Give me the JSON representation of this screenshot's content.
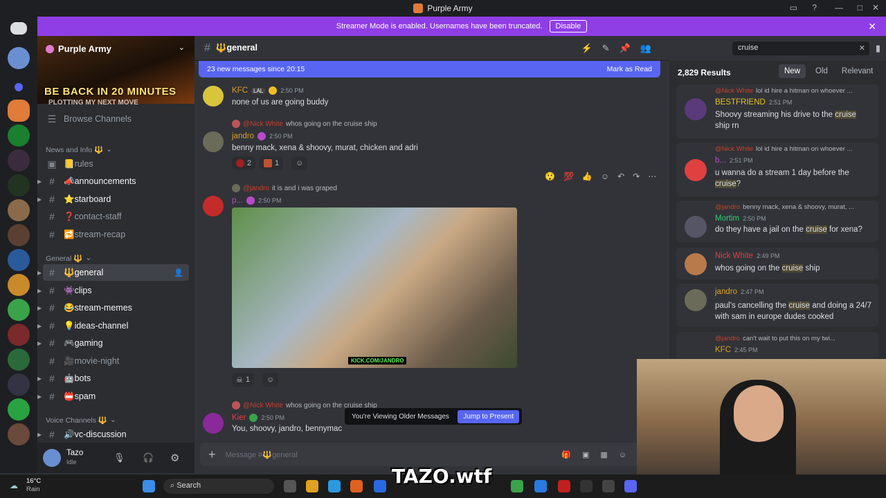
{
  "window": {
    "title": "Purple Army"
  },
  "banner": {
    "text": "Streamer Mode is enabled. Usernames have been truncated.",
    "button": "Disable"
  },
  "server": {
    "name": "Purple Army",
    "banner_text": "BE BACK IN 20 MINUTES",
    "banner_subtext": "PLOTTING MY NEXT MOVE",
    "browse": "Browse Channels",
    "categories": [
      {
        "name": "News and Info 🔱",
        "channels": [
          "📒rules",
          "📣announcements",
          "⭐starboard",
          "❓contact-staff",
          "🔁stream-recap"
        ]
      },
      {
        "name": "General 🔱",
        "channels": [
          "🔱general",
          "👾clips",
          "😂stream-memes",
          "💡ideas-channel",
          "🎮gaming",
          "🎥movie-night",
          "🤖bots",
          "📛spam"
        ]
      },
      {
        "name": "Voice Channels 🔱",
        "channels": [
          "🔊vc-discussion"
        ]
      }
    ]
  },
  "user": {
    "name": "Tazo",
    "status": "Idle"
  },
  "chat": {
    "channel": "🔱general",
    "new_messages": "23 new messages since 20:15",
    "mark_read": "Mark as Read",
    "messages": [
      {
        "author": "KFC",
        "tag": "LAL",
        "time": "2:50 PM",
        "text": "none of us are going buddy"
      },
      {
        "reply_name": "@Nick White",
        "reply_text": "whos going on the cruise ship",
        "author": "jandro",
        "time": "2:50 PM",
        "text": "benny mack, xena & shoovy, murat, chicken and adri",
        "reactions": [
          "2",
          "1"
        ]
      },
      {
        "reply_name": "@jandro",
        "reply_text": "it is and i was graped",
        "author": "p...",
        "time": "2:50 PM",
        "image_caption": "KICK.COM/JANDRO",
        "reactions": [
          "1"
        ]
      },
      {
        "reply_name": "@Nick White",
        "reply_text": "whos going on the cruise ship",
        "author": "Kier",
        "time": "2:50 PM",
        "text": "You, shoovy, jandro, bennymac"
      }
    ],
    "older_notice": "You're Viewing Older Messages",
    "jump": "Jump to Present",
    "input_placeholder": "Message #🔱general"
  },
  "search": {
    "query": "cruise",
    "count": "2,829 Results",
    "tabs": [
      "New",
      "Old",
      "Relevant"
    ],
    "results": [
      {
        "reply_name": "@Nick White",
        "reply_text": "lol id hire a hitman on whoever ...",
        "author": "BESTFRIEND",
        "time": "2:51 PM",
        "text_before": "Shoovy streaming his drive to the ",
        "hit": "cruise",
        "text_after": " ship rn"
      },
      {
        "reply_name": "@Nick White",
        "reply_text": "lol id hire a hitman on whoever ...",
        "author": "b...",
        "time": "2:51 PM",
        "text_before": "u wanna do a stream 1 day before the ",
        "hit": "cruise",
        "text_after": "?"
      },
      {
        "reply_name": "@jandro",
        "reply_text": "benny mack, xena & shoovy, murat, ...",
        "author": "Mortim",
        "time": "2:50 PM",
        "text_before": "do they have a jail on the ",
        "hit": "cruise",
        "text_after": " for xena?"
      },
      {
        "author": "Nick White",
        "time": "2:49 PM",
        "text_before": "whos going on the ",
        "hit": "cruise",
        "text_after": " ship"
      },
      {
        "author": "jandro",
        "time": "2:47 PM",
        "text_before": "paul's cancelling the ",
        "hit": "cruise",
        "text_after": " and doing a 24/7 with sam in europe dudes cooked"
      },
      {
        "reply_name": "@jandro",
        "reply_text": "can't wait to put this on my twi...",
        "author": "KFC",
        "time": "2:45 PM"
      }
    ]
  },
  "taskbar": {
    "temp": "16°C",
    "weather": "Rain",
    "search": "Search",
    "overlay": "TAZO.wtf"
  },
  "colors": {
    "accent": "#5865f2",
    "banner": "#8f3ee6"
  }
}
